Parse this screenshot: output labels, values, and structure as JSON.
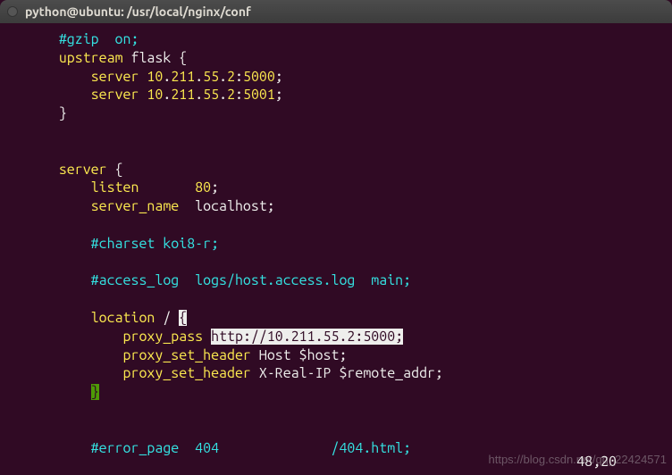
{
  "titlebar": {
    "title": "python@ubuntu: /usr/local/nginx/conf"
  },
  "lines": {
    "l1": "    #gzip  on;",
    "l2a": "    ",
    "l2b": "upstream",
    "l2c": " flask ",
    "l2d": "{",
    "l3a": "        ",
    "l3b": "server",
    "l3c": " ",
    "l3d": "10",
    "l3e": ".",
    "l3f": "211",
    "l3g": ".",
    "l3h": "55",
    "l3i": ".",
    "l3j": "2",
    "l3k": ":",
    "l3l": "5000",
    "l3m": ";",
    "l4a": "        ",
    "l4b": "server",
    "l4c": " ",
    "l4d": "10",
    "l4e": ".",
    "l4f": "211",
    "l4g": ".",
    "l4h": "55",
    "l4i": ".",
    "l4j": "2",
    "l4k": ":",
    "l4l": "5001",
    "l4m": ";",
    "l5a": "    ",
    "l5b": "}",
    "l6a": "    ",
    "l6b": "server",
    "l6c": " ",
    "l6d": "{",
    "l7a": "        ",
    "l7b": "listen",
    "l7c": "       ",
    "l7d": "80",
    "l7e": ";",
    "l8a": "        ",
    "l8b": "server_name",
    "l8c": "  localhost;",
    "l9": "        #charset koi8-r;",
    "l10": "        #access_log  logs/host.access.log  main;",
    "l11a": "        ",
    "l11b": "location",
    "l11c": " ",
    "l11d": "/",
    "l11e": " ",
    "l11f": "{",
    "l12a": "            ",
    "l12b": "proxy_pass",
    "l12c": " ",
    "l12d": "http://10.211.55.2:5000;",
    "l13a": "            ",
    "l13b": "proxy_set_header",
    "l13c": " Host $host;",
    "l14a": "            ",
    "l14b": "proxy_set_header",
    "l14c": " X-Real-IP $remote_addr;",
    "l15a": "        ",
    "l15b": "}",
    "l16": "        #error_page  404              /404.html;"
  },
  "status": {
    "position": "48,20"
  },
  "watermark": {
    "text": "https://blog.csdn.net/qq_22424571"
  }
}
